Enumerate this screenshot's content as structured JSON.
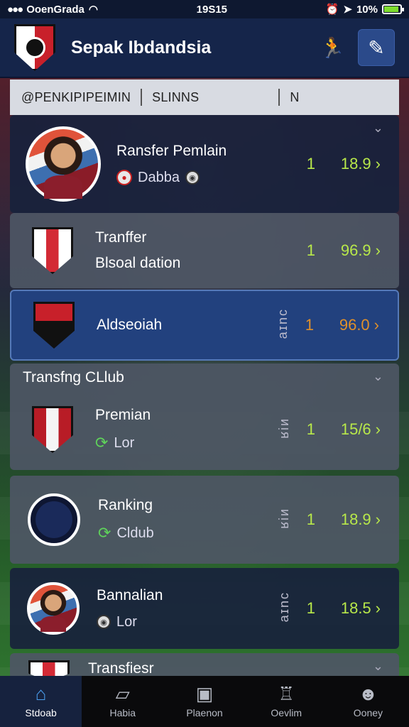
{
  "status": {
    "carrier": "OoenGrada",
    "time": "19S15",
    "battery": "10%"
  },
  "header": {
    "title": "Sepak Ibdandsia"
  },
  "filter": {
    "left_label": "@PENKIPIPEIMIN",
    "mid_label": "SLINNS",
    "right_label": "N"
  },
  "cards": [
    {
      "title": "Ransfer Pemlain",
      "sub": "Dabba",
      "rank": "1",
      "score": "18.9"
    },
    {
      "title": "Tranffer",
      "title2": "Blsoal dation",
      "rank": "1",
      "score": "96.9"
    },
    {
      "title": "Aldseoiah",
      "vertical": "ɔuɪɐ",
      "rank": "1",
      "score": "96.0"
    },
    {
      "section": "Transfng CLlub",
      "title": "Premian",
      "sub": "Lor",
      "vertical": "ᴎᴉᴙ",
      "rank": "1",
      "score": "15/6"
    },
    {
      "title": "Ranking",
      "sub": "Cldub",
      "vertical": "ᴎᴉᴙ",
      "rank": "1",
      "score": "18.9"
    },
    {
      "title": "Bannalian",
      "sub": "Lor",
      "vertical": "ɔuɪɐ",
      "rank": "1",
      "score": "18.5"
    },
    {
      "title": "Transfiesr"
    }
  ],
  "nav": [
    {
      "label": "Stdoab",
      "icon": "home-icon"
    },
    {
      "label": "Habia",
      "icon": "map-icon"
    },
    {
      "label": "Plaenon",
      "icon": "clipboard-icon"
    },
    {
      "label": "Oevlim",
      "icon": "trophy-icon"
    },
    {
      "label": "Ooney",
      "icon": "profile-icon"
    }
  ],
  "colors": {
    "accent": "#b8e84a",
    "highlight": "#e0902a",
    "header_bg": "#15254a"
  }
}
